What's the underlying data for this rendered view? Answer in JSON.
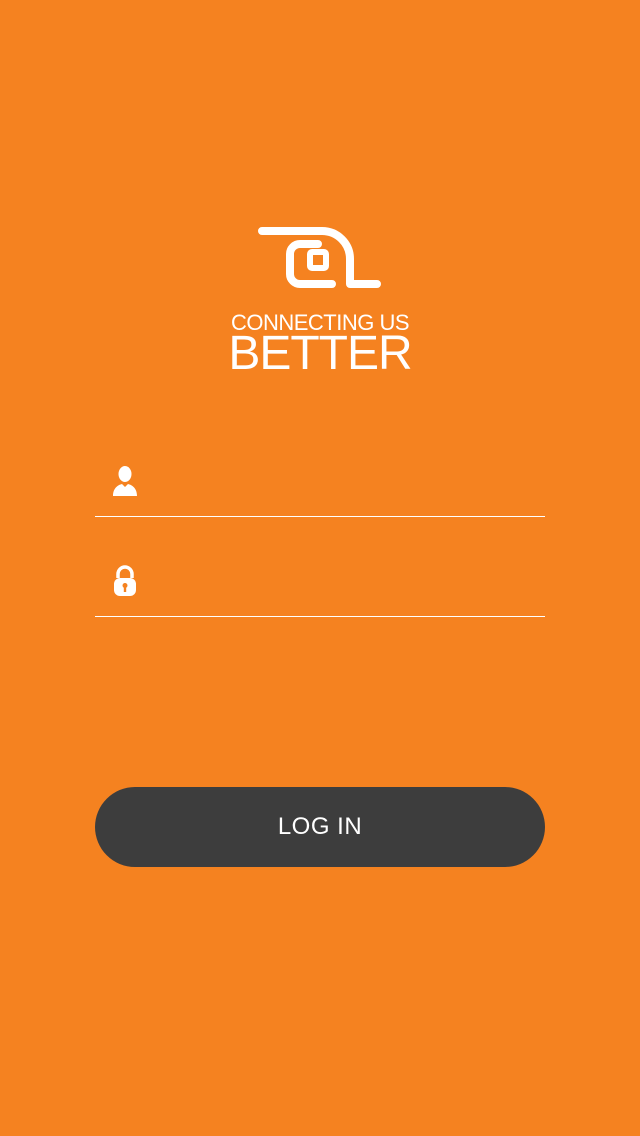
{
  "colors": {
    "background": "#F58220",
    "foreground": "#FFFFFF",
    "button": "#3D3D3D"
  },
  "branding": {
    "logo_icon": "at-sign-logo-icon",
    "tagline_top": "CONNECTING US",
    "tagline_bottom": "BETTER"
  },
  "form": {
    "username": {
      "icon": "user-icon",
      "value": "",
      "placeholder": ""
    },
    "password": {
      "icon": "lock-icon",
      "value": "",
      "placeholder": ""
    },
    "login_label": "LOG IN"
  }
}
